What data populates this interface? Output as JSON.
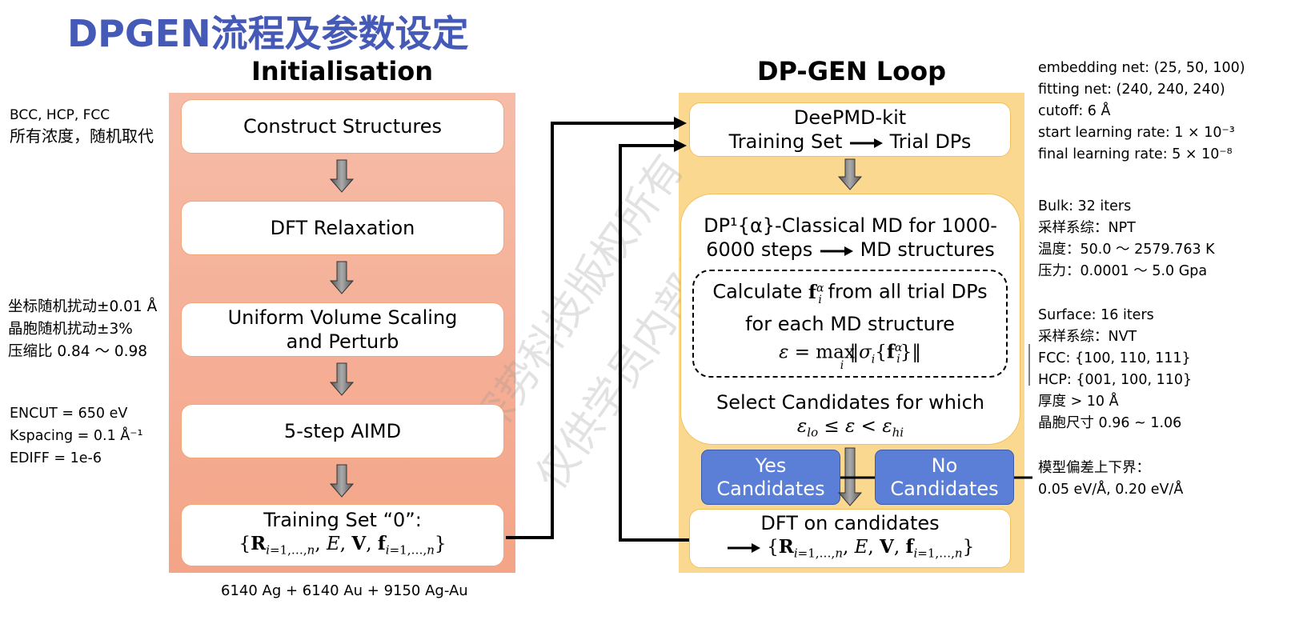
{
  "title": "DPGEN流程及参数设定",
  "init": {
    "heading": "Initialisation",
    "steps": [
      "Construct Structures",
      "DFT Relaxation"
    ],
    "uniform_1": "Uniform Volume Scaling",
    "uniform_2": "and Perturb",
    "aimd": "5-step AIMD",
    "training_set": "Training Set “0”:",
    "training_formula": "{R_{i=1,…,n}, E, V, f_{i=1,…,n}}",
    "footer": "6140 Ag + 6140 Au + 9150 Ag-Au"
  },
  "loop": {
    "heading": "DP-GEN Loop",
    "deepmd_1": "DeePMD-kit",
    "deepmd_2a": "Training Set",
    "deepmd_2b": "Trial DPs",
    "md_1": "DP¹{α}-Classical MD for 1000-",
    "md_2a": "6000 steps",
    "md_2b": "MD structures",
    "calc_1a": "Calculate",
    "calc_1b": "from all trial DPs",
    "calc_2": "for each MD structure",
    "calc_formula": "ε = max‖σᵢ{fᵢᵅ}‖",
    "select_1": "Select Candidates for which",
    "select_formula": "ε_lo ≤ ε < ε_hi",
    "yes_1": "Yes",
    "yes_2": "Candidates",
    "no_1": "No",
    "no_2": "Candidates",
    "dft_1": "DFT on candidates",
    "dft_formula": "{R_{i=1,…,n}, E, V, f_{i=1,…,n}}"
  },
  "left_notes": {
    "structures": [
      "BCC, HCP, FCC",
      "所有浓度，随机取代"
    ],
    "perturb": [
      "坐标随机扰动±0.01 Å",
      "晶胞随机扰动±3%",
      "压缩比 0.84 ～ 0.98"
    ],
    "dft": [
      "ENCUT = 650 eV",
      "Kspacing = 0.1 Å⁻¹",
      "EDIFF = 1e-6"
    ]
  },
  "right_notes": {
    "training": [
      "embedding net: (25, 50, 100)",
      "fitting net: (240, 240, 240)",
      "cutoff: 6 Å",
      "start learning rate: 1 × 10⁻³",
      "final learning rate: 5 × 10⁻⁸"
    ],
    "bulk": [
      "Bulk: 32 iters",
      "采样系综：NPT",
      "温度：50.0 ～ 2579.763 K",
      "压力：0.0001 ～ 5.0 Gpa"
    ],
    "surface": [
      "Surface: 16 iters",
      "采样系综：NVT",
      "FCC: {100, 110, 111}",
      "HCP: {001, 100, 110}",
      "厚度 > 10 Å",
      "晶胞尺寸 0.96 ~ 1.06"
    ],
    "deviation": [
      "模型偏差上下界：",
      "0.05 eV/Å, 0.20 eV/Å"
    ]
  },
  "watermark": [
    "深势科技版权所有",
    "仅供学员内部使用"
  ],
  "colors": {
    "title": "#4559b7",
    "init_panel": "#f4a487",
    "loop_panel": "#fbd88f",
    "candidate_box": "#5b7fd6"
  }
}
